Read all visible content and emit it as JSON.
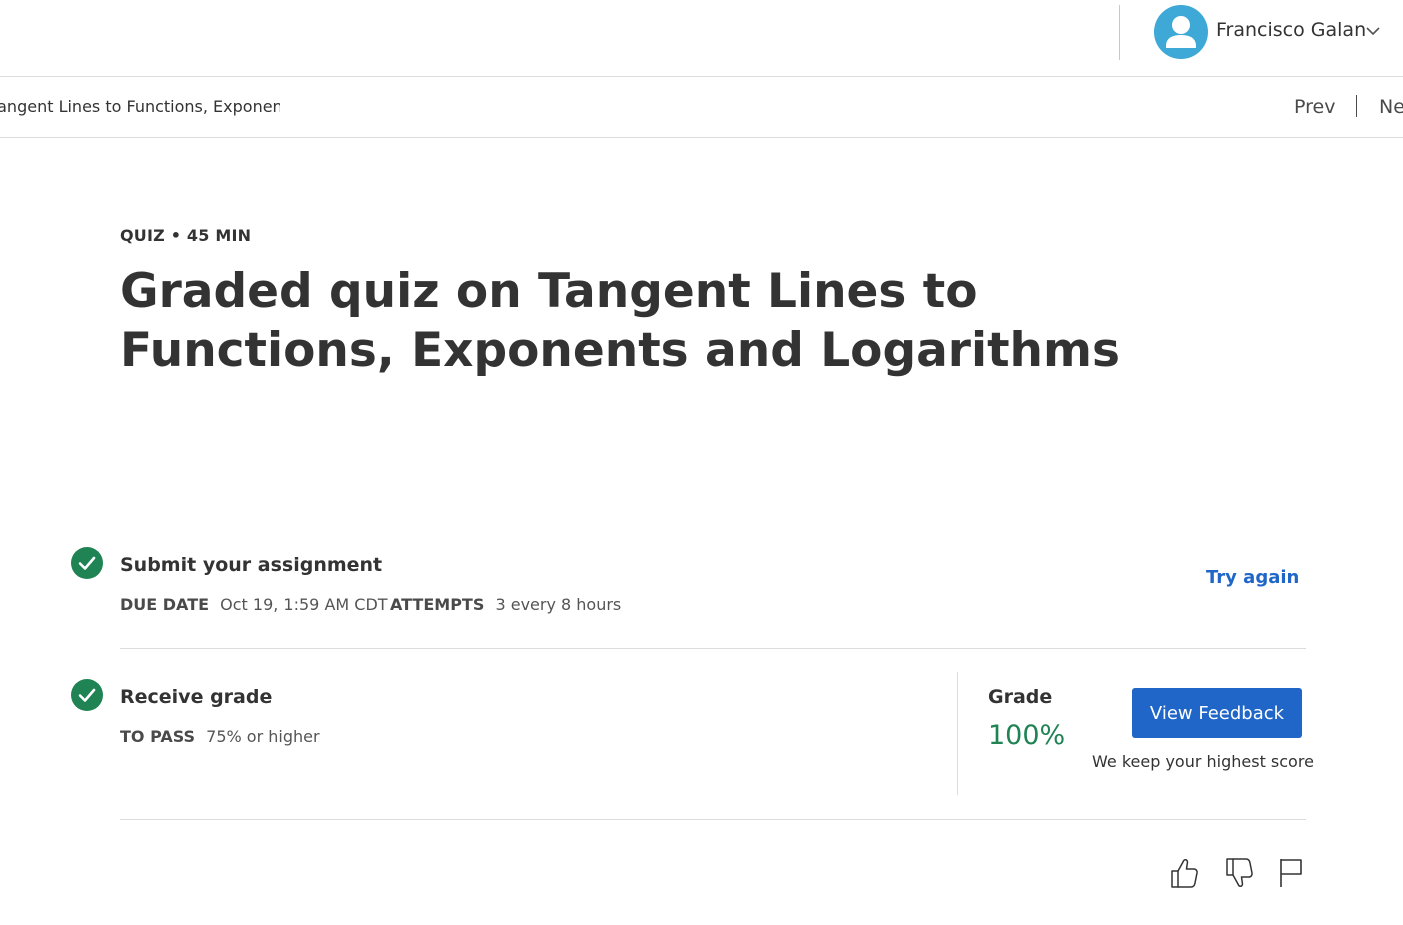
{
  "header": {
    "user_name": "Francisco Galan",
    "avatar_icon": "user-avatar-icon",
    "menu_icon": "chevron-down-icon"
  },
  "breadcrumb": {
    "text": "Tangent Lines to Functions, Exponents and Logarithms",
    "prev_label": "Prev",
    "next_label": "Next"
  },
  "quiz": {
    "kicker": "QUIZ • 45 MIN",
    "title": "Graded quiz on Tangent Lines to Functions, Exponents and Logarithms"
  },
  "submit_step": {
    "title": "Submit your assignment",
    "status_icon": "check-circle-icon",
    "due_label": "DUE DATE",
    "due_value": "Oct 19, 1:59 AM CDT",
    "attempts_label": "ATTEMPTS",
    "attempts_value": "3 every 8 hours",
    "try_again_label": "Try again"
  },
  "grade_step": {
    "title": "Receive grade",
    "status_icon": "check-circle-icon",
    "pass_label": "TO PASS",
    "pass_value": "75% or higher",
    "grade_label": "Grade",
    "grade_value": "100%",
    "feedback_button": "View Feedback",
    "note": "We keep your highest score"
  },
  "actions": {
    "like_icon": "thumbs-up-icon",
    "dislike_icon": "thumbs-down-icon",
    "report_icon": "flag-icon"
  },
  "colors": {
    "accent": "#1f66c8",
    "success": "#1f8354",
    "avatar": "#3ea8d6"
  }
}
